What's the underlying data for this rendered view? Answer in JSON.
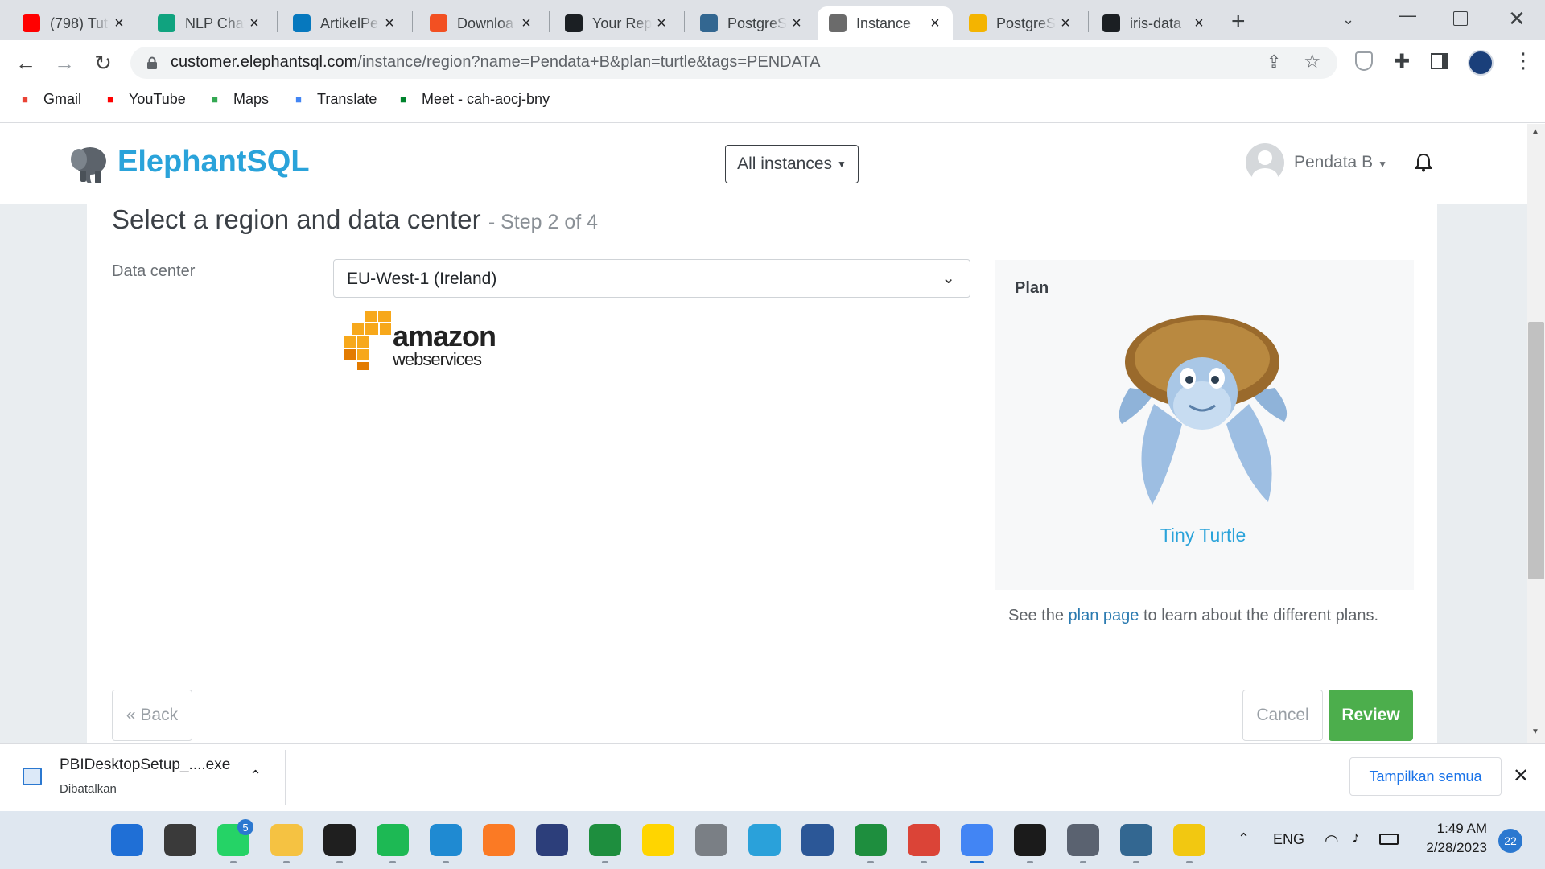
{
  "browser": {
    "tabs": [
      {
        "label": "(798) Tut",
        "icon": "youtube-icon",
        "color": "#ff0000"
      },
      {
        "label": "NLP Chat",
        "icon": "chatgpt-icon",
        "color": "#10a37f"
      },
      {
        "label": "ArtikelPe",
        "icon": "drupal-icon",
        "color": "#0678be"
      },
      {
        "label": "Downloa",
        "icon": "microsoft-icon",
        "color": "#f25022"
      },
      {
        "label": "Your Rep",
        "icon": "github-icon",
        "color": "#1b1f23"
      },
      {
        "label": "PostgreS",
        "icon": "postgres-icon",
        "color": "#336791"
      },
      {
        "label": "Instance",
        "icon": "elephantsql-icon",
        "color": "#6b6b6b",
        "active": true
      },
      {
        "label": "PostgreS",
        "icon": "sparkle-icon",
        "color": "#f4b400"
      },
      {
        "label": "iris-data",
        "icon": "github-icon",
        "color": "#1b1f23"
      }
    ],
    "url_host": "customer.elephantsql.com",
    "url_path": "/instance/region?name=Pendata+B&plan=turtle&tags=PENDATA",
    "bookmarks": [
      {
        "label": "Gmail",
        "icon": "gmail-icon",
        "color": "#ea4335"
      },
      {
        "label": "YouTube",
        "icon": "youtube-icon",
        "color": "#ff0000"
      },
      {
        "label": "Maps",
        "icon": "maps-icon",
        "color": "#34a853"
      },
      {
        "label": "Translate",
        "icon": "translate-icon",
        "color": "#4285f4"
      },
      {
        "label": "Meet - cah-aocj-bny",
        "icon": "meet-icon",
        "color": "#00832d"
      }
    ]
  },
  "site": {
    "brand": "ElephantSQL",
    "brand_color": "#2aa3da",
    "instances_dropdown": "All instances",
    "user_name": "Pendata B"
  },
  "wizard": {
    "title": "Select a region and data center",
    "step": "- Step 2 of 4",
    "dc_label": "Data center",
    "dc_value": "EU-West-1 (Ireland)",
    "provider_line1": "amazon",
    "provider_line2": "webservices",
    "plan_label": "Plan",
    "plan_name": "Tiny Turtle",
    "note_before": "See the",
    "note_link": "plan page",
    "note_after": "to learn about the different plans.",
    "back_label": "« Back",
    "cancel_label": "Cancel",
    "review_label": "Review",
    "review_color": "#4cae4c"
  },
  "download_bar": {
    "file_name": "PBIDesktopSetup_....exe",
    "status": "Dibatalkan",
    "show_all": "Tampilkan semua"
  },
  "taskbar": {
    "whatsapp_badge": "5",
    "lang": "ENG",
    "time": "1:49 AM",
    "date": "2/28/2023",
    "notification_count": "22",
    "apps": [
      {
        "name": "start-icon",
        "color": "#1f6fd6"
      },
      {
        "name": "task-view-icon",
        "color": "#3a3a3a"
      },
      {
        "name": "whatsapp-icon",
        "color": "#25d366"
      },
      {
        "name": "file-explorer-icon",
        "color": "#f5c242"
      },
      {
        "name": "skype-icon",
        "color": "#1f1f1f"
      },
      {
        "name": "spotify-icon",
        "color": "#1db954"
      },
      {
        "name": "vscode-icon",
        "color": "#1f8ad2"
      },
      {
        "name": "xampp-icon",
        "color": "#fb7a24"
      },
      {
        "name": "devc-icon",
        "color": "#2c3e7a"
      },
      {
        "name": "classroom-icon",
        "color": "#1e8e3e"
      },
      {
        "name": "edmodo-icon",
        "color": "#ffd500"
      },
      {
        "name": "cisco-icon",
        "color": "#7a7f85"
      },
      {
        "name": "telegram-icon",
        "color": "#2aa1da"
      },
      {
        "name": "word-icon",
        "color": "#2b5797"
      },
      {
        "name": "classroom2-icon",
        "color": "#1e8e3e"
      },
      {
        "name": "chrome-icon",
        "color": "#db4437"
      },
      {
        "name": "chrome-profile-icon",
        "color": "#4285f4"
      },
      {
        "name": "typora-icon",
        "color": "#1b1b1b"
      },
      {
        "name": "settings-icon",
        "color": "#5a6270"
      },
      {
        "name": "pgadmin-icon",
        "color": "#336791"
      },
      {
        "name": "powerbi-icon",
        "color": "#f2c811"
      }
    ]
  }
}
